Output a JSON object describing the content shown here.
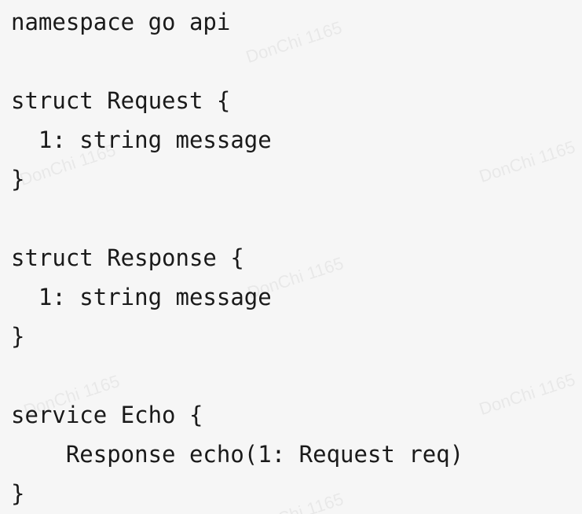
{
  "code": {
    "lines": [
      "namespace go api",
      "",
      "struct Request {",
      "  1: string message",
      "}",
      "",
      "struct Response {",
      "  1: string message",
      "}",
      "",
      "service Echo {",
      "    Response echo(1: Request req)",
      "}"
    ]
  },
  "watermark": {
    "text": "DonChi 1165"
  }
}
